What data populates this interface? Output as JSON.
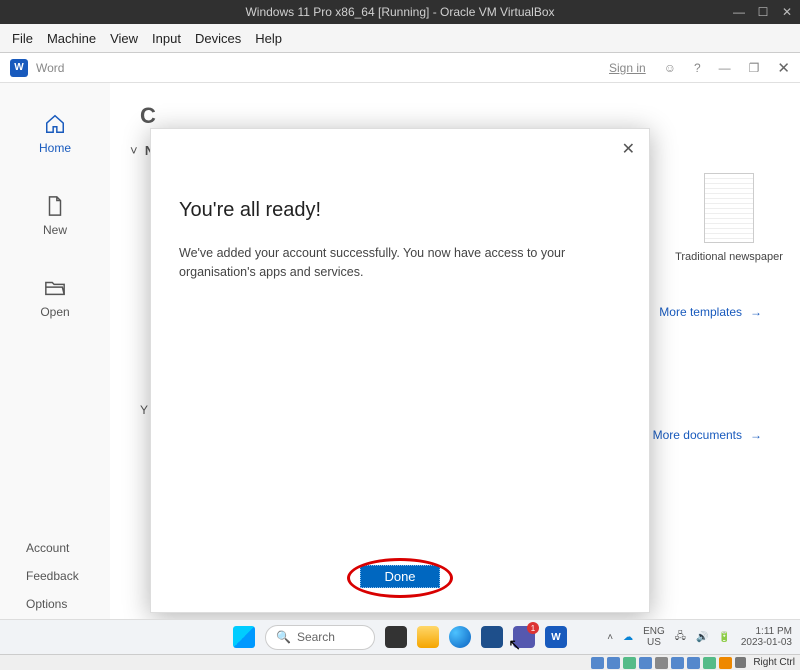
{
  "vb": {
    "title": "Windows 11 Pro x86_64 [Running] - Oracle VM VirtualBox",
    "menu": [
      "File",
      "Machine",
      "View",
      "Input",
      "Devices",
      "Help"
    ],
    "host_key": "Right Ctrl"
  },
  "word": {
    "title": "Word",
    "header": {
      "sign_in": "Sign in"
    },
    "sidebar": {
      "home": "Home",
      "new": "New",
      "open": "Open",
      "account": "Account",
      "feedback": "Feedback",
      "options": "Options"
    },
    "main": {
      "hidden_letter": "N",
      "template_caption": "Traditional newspaper",
      "more_templates": "More templates",
      "more_documents": "More documents"
    }
  },
  "dialog": {
    "heading": "You're all ready!",
    "body": "We've added your account successfully. You now have access to your organisation's apps and services.",
    "done": "Done"
  },
  "taskbar": {
    "search": "Search",
    "lang1": "ENG",
    "lang2": "US",
    "time": "1:11 PM",
    "date": "2023-01-03"
  }
}
